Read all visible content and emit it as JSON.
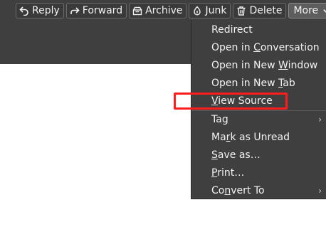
{
  "toolbar": {
    "reply": {
      "label": "Reply",
      "icon": "reply-icon"
    },
    "forward": {
      "label": "Forward",
      "icon": "forward-icon"
    },
    "archive": {
      "label": "Archive",
      "icon": "archive-icon"
    },
    "junk": {
      "label": "Junk",
      "icon": "junk-icon"
    },
    "delete": {
      "label": "Delete",
      "icon": "trash-icon"
    },
    "more": {
      "label": "More",
      "icon": "chevron-down-icon"
    }
  },
  "more_menu": {
    "items": [
      {
        "pre": "Redirect",
        "key": "",
        "post": "",
        "submenu": false
      },
      {
        "pre": "Open in ",
        "key": "C",
        "post": "onversation",
        "submenu": false
      },
      {
        "pre": "Open in New ",
        "key": "W",
        "post": "indow",
        "submenu": false
      },
      {
        "pre": "Open in New ",
        "key": "T",
        "post": "ab",
        "submenu": false
      },
      {
        "pre": "",
        "key": "V",
        "post": "iew Source",
        "submenu": false
      },
      {
        "pre": "Ta",
        "key": "g",
        "post": "",
        "submenu": true
      },
      {
        "pre": "Ma",
        "key": "r",
        "post": "k as Unread",
        "submenu": false
      },
      {
        "pre": "",
        "key": "S",
        "post": "ave as…",
        "submenu": false
      },
      {
        "pre": "",
        "key": "P",
        "post": "rint…",
        "submenu": false
      },
      {
        "pre": "Co",
        "key": "n",
        "post": "vert To",
        "submenu": true
      }
    ],
    "submenu_arrow": "›"
  },
  "colors": {
    "header_bg": "#3f3f3f",
    "menu_bg": "#3f3f3f",
    "highlight": "#ff1c1c"
  }
}
